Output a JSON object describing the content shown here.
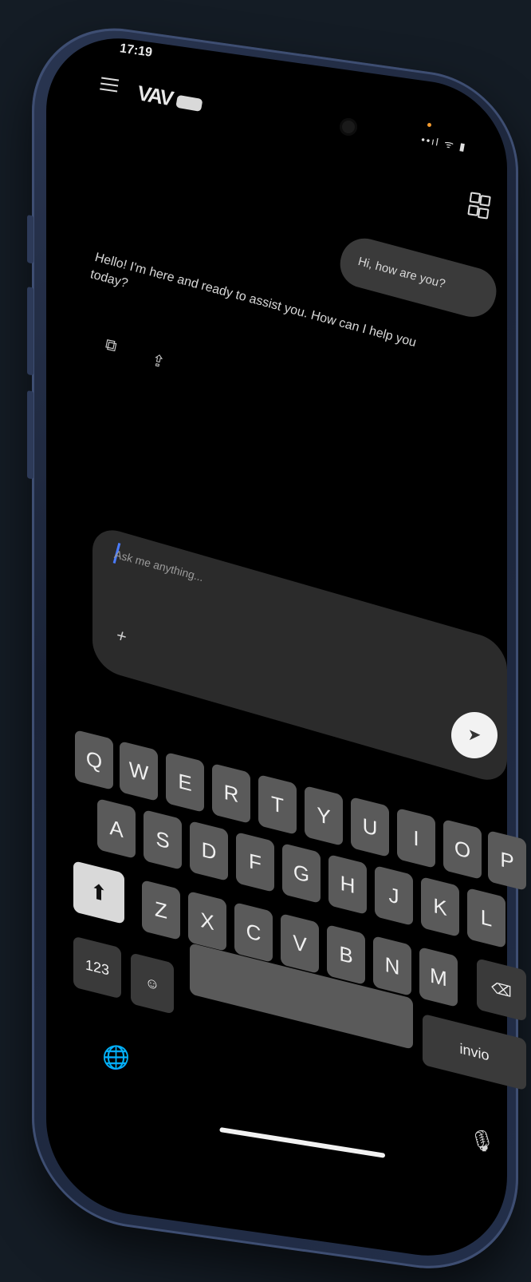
{
  "status_bar": {
    "time": "17:19",
    "signal_icons": "••ıl ᯤ ▮"
  },
  "header": {
    "logo_text": "VAV",
    "grid_icon": "apps-grid-icon",
    "menu_icon": "menu-icon"
  },
  "chat": {
    "user_message": "Hi, how are you?",
    "assistant_message": "Hello! I'm here and ready to assist you. How can I help you today?",
    "copy_icon": "⧉",
    "share_icon": "⇪"
  },
  "composer": {
    "placeholder": "Ask me anything...",
    "plus_label": "+",
    "send_label": "➤"
  },
  "keyboard": {
    "row1": [
      "Q",
      "W",
      "E",
      "R",
      "T",
      "Y",
      "U",
      "I",
      "O",
      "P"
    ],
    "row2": [
      "A",
      "S",
      "D",
      "F",
      "G",
      "H",
      "J",
      "K",
      "L"
    ],
    "row3": [
      "Z",
      "X",
      "C",
      "V",
      "B",
      "N",
      "M"
    ],
    "shift_label": "⬆",
    "delete_label": "⌫",
    "numbers_label": "123",
    "emoji_label": "☺",
    "globe_label": "🌐",
    "return_label": "invio",
    "mic_label": "🎙"
  },
  "colors": {
    "background": "#141c25",
    "screen": "#000000",
    "bubble": "#3a3a3a",
    "key": "#5a5a5a",
    "caret": "#4a7cff"
  }
}
